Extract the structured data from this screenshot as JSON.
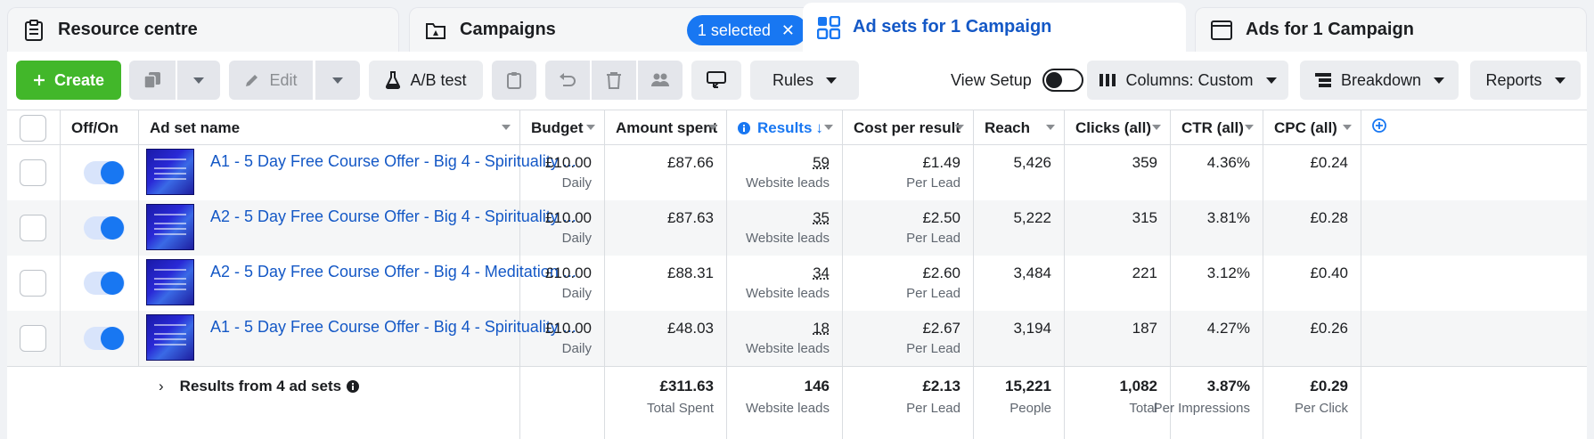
{
  "tabs": {
    "resource": "Resource centre",
    "campaigns": "Campaigns",
    "selected_badge": "1 selected",
    "adsets": "Ad sets for 1 Campaign",
    "ads": "Ads for 1 Campaign"
  },
  "toolbar": {
    "create": "Create",
    "edit": "Edit",
    "ab_test": "A/B test",
    "rules": "Rules",
    "view_setup": "View Setup",
    "columns": "Columns: Custom",
    "breakdown": "Breakdown",
    "reports": "Reports"
  },
  "columns": {
    "off_on": "Off/On",
    "name": "Ad set name",
    "budget": "Budget",
    "amount_spent": "Amount spent",
    "results": "Results",
    "cost_per_result": "Cost per result",
    "reach": "Reach",
    "clicks": "Clicks (all)",
    "ctr": "CTR (all)",
    "cpc": "CPC (all)"
  },
  "rows": [
    {
      "name": "A1 - 5 Day Free Course Offer - Big 4 - Spirituality ...",
      "budget": "£10.00",
      "budget_sub": "Daily",
      "spent": "£87.66",
      "results": "59",
      "results_sub": "Website leads",
      "cpr": "£1.49",
      "cpr_sub": "Per Lead",
      "reach": "5,426",
      "clicks": "359",
      "ctr": "4.36%",
      "cpc": "£0.24"
    },
    {
      "name": "A2 - 5 Day Free Course Offer - Big 4 - Spirituality ...",
      "budget": "£10.00",
      "budget_sub": "Daily",
      "spent": "£87.63",
      "results": "35",
      "results_sub": "Website leads",
      "cpr": "£2.50",
      "cpr_sub": "Per Lead",
      "reach": "5,222",
      "clicks": "315",
      "ctr": "3.81%",
      "cpc": "£0.28"
    },
    {
      "name": "A2 - 5 Day Free Course Offer - Big 4 - Meditation ...",
      "budget": "£10.00",
      "budget_sub": "Daily",
      "spent": "£88.31",
      "results": "34",
      "results_sub": "Website leads",
      "cpr": "£2.60",
      "cpr_sub": "Per Lead",
      "reach": "3,484",
      "clicks": "221",
      "ctr": "3.12%",
      "cpc": "£0.40"
    },
    {
      "name": "A1 - 5 Day Free Course Offer - Big 4 - Spirituality ...",
      "budget": "£10.00",
      "budget_sub": "Daily",
      "spent": "£48.03",
      "results": "18",
      "results_sub": "Website leads",
      "cpr": "£2.67",
      "cpr_sub": "Per Lead",
      "reach": "3,194",
      "clicks": "187",
      "ctr": "4.27%",
      "cpc": "£0.26"
    }
  ],
  "footer": {
    "label": "Results from 4 ad sets",
    "spent": "£311.63",
    "spent_sub": "Total Spent",
    "results": "146",
    "results_sub": "Website leads",
    "cpr": "£2.13",
    "cpr_sub": "Per Lead",
    "reach": "15,221",
    "reach_sub": "People",
    "clicks": "1,082",
    "clicks_sub": "Total",
    "ctr": "3.87%",
    "ctr_sub": "Per Impressions",
    "cpc": "£0.29",
    "cpc_sub": "Per Click"
  },
  "colors": {
    "accent": "#1877f2",
    "create": "#42b72a",
    "link": "#1458c6"
  }
}
